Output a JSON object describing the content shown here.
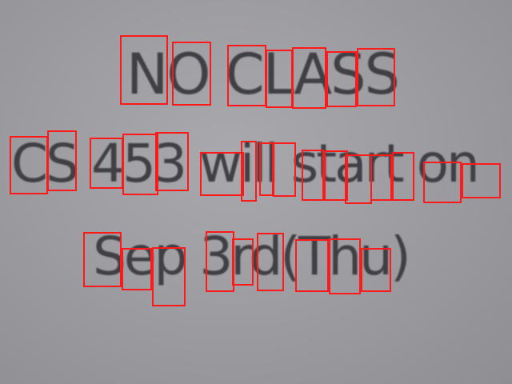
{
  "sign": {
    "line1": "NO CLASS",
    "line2": "CS 453 will start on",
    "line3": "Sep 3rd(Thu)"
  },
  "colors": {
    "background": "#9e9da2",
    "text": "#3f3f44",
    "box_outline": "#ff1a1a"
  }
}
